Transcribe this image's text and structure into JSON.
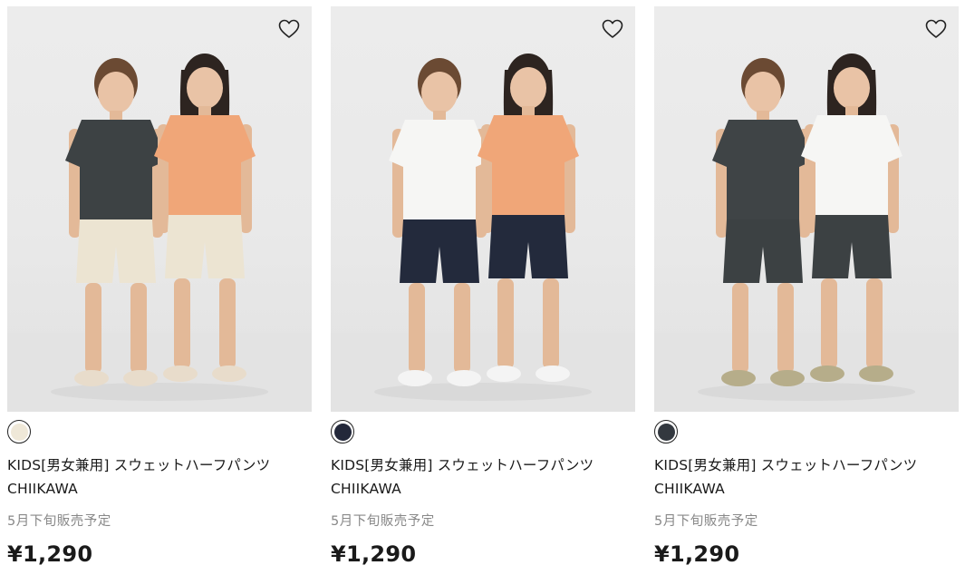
{
  "products": [
    {
      "name_line1": "KIDS[男女兼用] スウェットハーフパンツ",
      "name_line2": "CHIIKAWA",
      "release": "5月下旬販売予定",
      "price": "¥1,290",
      "swatch_color": "#efe8d8",
      "icon": "heart-icon",
      "shirt_left": "#3d4244",
      "shirt_right": "#f0a678",
      "pants_left": "#ece4d2",
      "pants_right": "#ece4d2",
      "shoes": "#e8dccb"
    },
    {
      "name_line1": "KIDS[男女兼用] スウェットハーフパンツ",
      "name_line2": "CHIIKAWA",
      "release": "5月下旬販売予定",
      "price": "¥1,290",
      "swatch_color": "#23283a",
      "icon": "heart-icon",
      "shirt_left": "#f6f6f4",
      "shirt_right": "#f0a678",
      "pants_left": "#232a3c",
      "pants_right": "#232a3c",
      "shoes": "#f4f4f4"
    },
    {
      "name_line1": "KIDS[男女兼用] スウェットハーフパンツ",
      "name_line2": "CHIIKAWA",
      "release": "5月下旬販売予定",
      "price": "¥1,290",
      "swatch_color": "#33383f",
      "icon": "heart-icon",
      "shirt_left": "#3f4446",
      "shirt_right": "#f6f6f4",
      "pants_left": "#3c4143",
      "pants_right": "#3c4143",
      "shoes": "#b6ad8a"
    }
  ]
}
